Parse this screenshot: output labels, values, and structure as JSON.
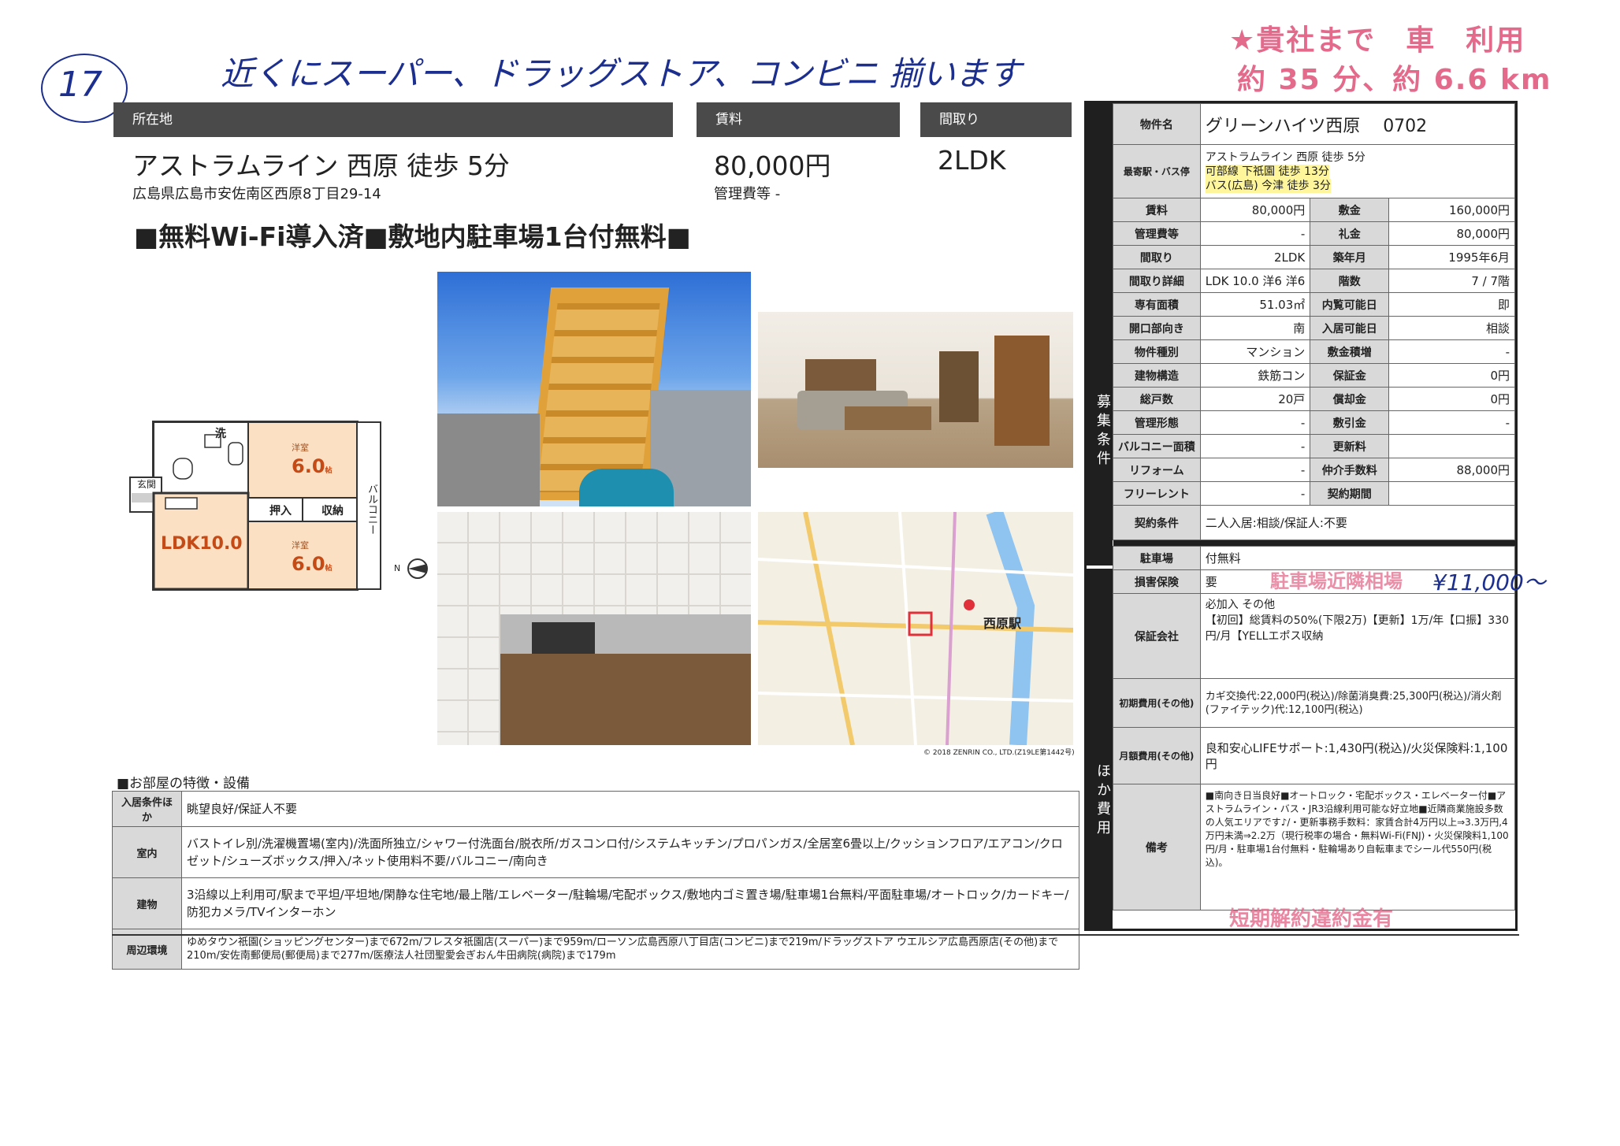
{
  "handwritten": {
    "number": "17",
    "note": "近くにスーパー、ドラッグストア、コンビニ 揃います",
    "commute_line1": "★貴社まで　車　利用",
    "commute_line2": "約 35 分、約 6.6 km",
    "parking_fee": "¥11,000〜"
  },
  "stamps": {
    "parking_stamp": "駐車場近隣相場",
    "bottom_stamp": "短期解約違約金有"
  },
  "header": {
    "location_label": "所在地",
    "rent_label": "賃料",
    "layout_label": "間取り",
    "access": "アストラムライン 西原 徒歩 5分",
    "address": "広島県広島市安佐南区西原8丁目29-14",
    "rent": "80,000円",
    "mgmt_fee": "管理費等 -",
    "layout": "2LDK",
    "promo": "■無料Wi-Fi導入済■敷地内駐車場1台付無料■"
  },
  "floorplan": {
    "room1": "洋室",
    "room1_size": "6.0",
    "room2": "洋室",
    "room2_size": "6.0",
    "ldk": "LDK10.0",
    "wash": "洗",
    "entrance": "玄関",
    "closet1": "押入",
    "closet2": "収納",
    "balcony": "バルコニー",
    "unit": "帖",
    "north": "N"
  },
  "map": {
    "station": "西原駅",
    "credit": "© 2018 ZENRIN CO., LTD.(Z19LE第1442号)"
  },
  "right_table": {
    "title_label": "物件名",
    "title": "グリーンハイツ西原　 0702",
    "station_label": "最寄駅・バス停",
    "station_lines": [
      "アストラムライン 西原 徒歩 5分",
      "可部線 下祇園 徒歩 13分",
      "バス(広島) 今津 徒歩 3分"
    ],
    "side_label_top": "募集条件",
    "side_label_bottom": "ほか費用",
    "rows": [
      {
        "k1": "賃料",
        "v1": "80,000円",
        "k2": "敷金",
        "v2": "160,000円"
      },
      {
        "k1": "管理費等",
        "v1": "-",
        "k2": "礼金",
        "v2": "80,000円"
      },
      {
        "k1": "間取り",
        "v1": "2LDK",
        "k2": "築年月",
        "v2": "1995年6月"
      },
      {
        "k1": "間取り詳細",
        "v1": "LDK 10.0 洋6 洋6",
        "k2": "階数",
        "v2": "7 / 7階"
      },
      {
        "k1": "専有面積",
        "v1": "51.03㎡",
        "k2": "内覧可能日",
        "v2": "即"
      },
      {
        "k1": "開口部向き",
        "v1": "南",
        "k2": "入居可能日",
        "v2": "相談"
      },
      {
        "k1": "物件種別",
        "v1": "マンション",
        "k2": "敷金積増",
        "v2": "-"
      },
      {
        "k1": "建物構造",
        "v1": "鉄筋コン",
        "k2": "保証金",
        "v2": "0円"
      },
      {
        "k1": "総戸数",
        "v1": "20戸",
        "k2": "償却金",
        "v2": "0円"
      },
      {
        "k1": "管理形態",
        "v1": "-",
        "k2": "敷引金",
        "v2": "-"
      },
      {
        "k1": "バルコニー面積",
        "v1": "-",
        "k2": "更新料",
        "v2": ""
      },
      {
        "k1": "リフォーム",
        "v1": "-",
        "k2": "仲介手数料",
        "v2": "88,000円"
      },
      {
        "k1": "フリーレント",
        "v1": "-",
        "k2": "契約期間",
        "v2": ""
      }
    ],
    "contract_label": "契約条件",
    "contract": "二人入居:相談/保証人:不要",
    "parking_label": "駐車場",
    "parking": "付無料",
    "insurance_label": "損害保険",
    "insurance": "要",
    "guarantor_label": "保証会社",
    "guarantor": "必加入 その他\n【初回】総賃料の50%(下限2万)【更新】1万/年【口振】330円/月【YELLエポス収納",
    "initial_label": "初期費用(その他)",
    "initial": "カギ交換代:22,000円(税込)/除菌消臭費:25,300円(税込)/消火剤(ファイテック)代:12,100円(税込)",
    "monthly_label": "月額費用(その他)",
    "monthly": "良和安心LIFEサポート:1,430円(税込)/火災保険料:1,100円",
    "remarks_label": "備考",
    "remarks": "■南向き日当良好■オートロック・宅配ボックス・エレベーター付■アストラムライン・バス・JR3沿線利用可能な好立地■近隣商業施設多数の人気エリアです♪/・更新事務手数料：家賃合計4万円以上⇒3.3万円,4万円未満⇒2.2万（現行税率の場合・無料Wi-Fi(FNJ)・火災保険料1,100円/月・駐車場1台付無料・駐輪場あり自転車までシール代550円(税込)。"
  },
  "features": {
    "title": "■お部屋の特徴・設備",
    "rows": [
      {
        "label": "入居条件ほか",
        "text": "眺望良好/保証人不要"
      },
      {
        "label": "室内",
        "text": "バストイレ別/洗濯機置場(室内)/洗面所独立/シャワー付洗面台/脱衣所/ガスコンロ付/システムキッチン/プロパンガス/全居室6畳以上/クッションフロア/エアコン/クロゼット/シューズボックス/押入/ネット使用料不要/バルコニー/南向き"
      },
      {
        "label": "建物",
        "text": "3沿線以上利用可/駅まで平坦/平坦地/閑静な住宅地/最上階/エレベーター/駐輪場/宅配ボックス/敷地内ゴミ置き場/駐車場1台無料/平面駐車場/オートロック/カードキー/防犯カメラ/TVインターホン"
      },
      {
        "label": "周辺環境",
        "text": "ゆめタウン祇園(ショッピングセンター)まで672m/フレスタ祇園店(スーパー)まで959m/ローソン広島西原八丁目店(コンビニ)まで219m/ドラッグストア ウエルシア広島西原店(その他)まで210m/安佐南郵便局(郵便局)まで277m/医療法人社団聖愛会ぎおん牛田病院(病院)まで179m"
      }
    ]
  },
  "colors": {
    "header_bg": "#4a4a4a",
    "key_bg": "#d9d9d9",
    "handwriting": "#1c2f8f",
    "stamp": "#e46a8c",
    "building": "#e0a13a"
  }
}
